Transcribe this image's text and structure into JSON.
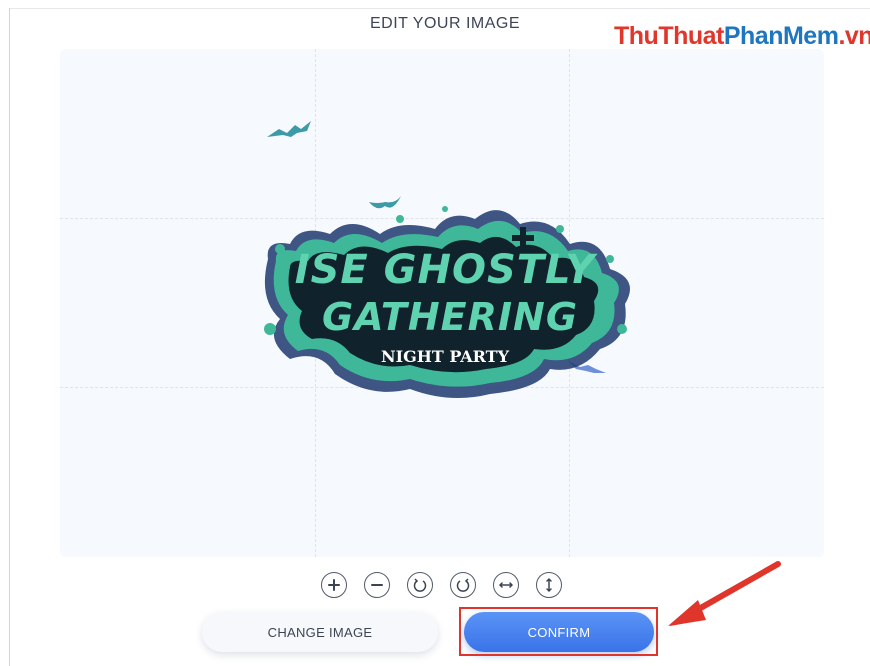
{
  "header": {
    "title": "EDIT YOUR IMAGE"
  },
  "watermark": {
    "part1": "ThuThuat",
    "part2": "PhanMem",
    "part3": ".vn"
  },
  "artwork": {
    "line1": "ISE GHOSTLY",
    "line2": "GATHERING",
    "line3": "NIGHT PARTY"
  },
  "toolbar": {
    "tools": [
      "zoom-in",
      "zoom-out",
      "rotate-left",
      "rotate-right",
      "flip-horizontal",
      "flip-vertical"
    ]
  },
  "actions": {
    "change_label": "CHANGE IMAGE",
    "confirm_label": "CONFIRM"
  },
  "colors": {
    "accent": "#4a85f0",
    "highlight": "#e0352b",
    "artwork_green": "#3fb89a",
    "artwork_dark": "#10222c"
  }
}
